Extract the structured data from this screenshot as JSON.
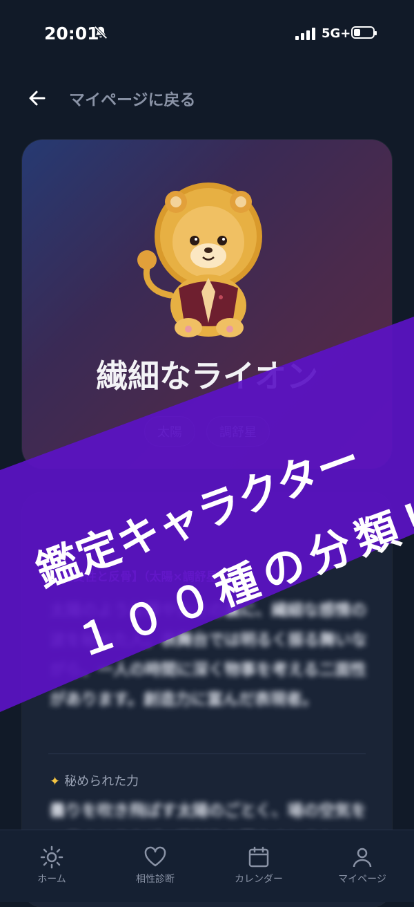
{
  "status_bar": {
    "time": "20:01",
    "network": "5G+",
    "icons": [
      "bell-muted-icon",
      "signal-icon",
      "battery-icon"
    ]
  },
  "header": {
    "back_label": "マイページに戻る",
    "back_icon": "arrow-left-icon"
  },
  "hero": {
    "character_name": "繊細なライオン",
    "tags": [
      "太陽",
      "調舒星"
    ],
    "mascot": "lion-mascot"
  },
  "detail": {
    "eyebrow": "",
    "subtitle": "【感受性と反骨】（太陽×調舒星）",
    "body": "太陽のような華やかさの裏に、繊細な感情の波を秘めた人。表舞台では明るく振る舞いながら、一人の時間に深く物事を考える二面性があります。創造力に富んだ表現者。",
    "power_label": "秘められた力",
    "power_body": "曇りを吹き飛ばす太陽のごとく、場の空気を一変させる力が。両創作を暮らすときも、"
  },
  "banner": {
    "line1": "鑑定キャラクター",
    "line2": "１００種の分類！",
    "color": "#5b12c4"
  },
  "bottom_nav": [
    {
      "label": "ホーム",
      "icon": "sun-icon"
    },
    {
      "label": "相性診断",
      "icon": "heart-icon"
    },
    {
      "label": "カレンダー",
      "icon": "calendar-icon"
    },
    {
      "label": "マイページ",
      "icon": "user-icon"
    }
  ]
}
